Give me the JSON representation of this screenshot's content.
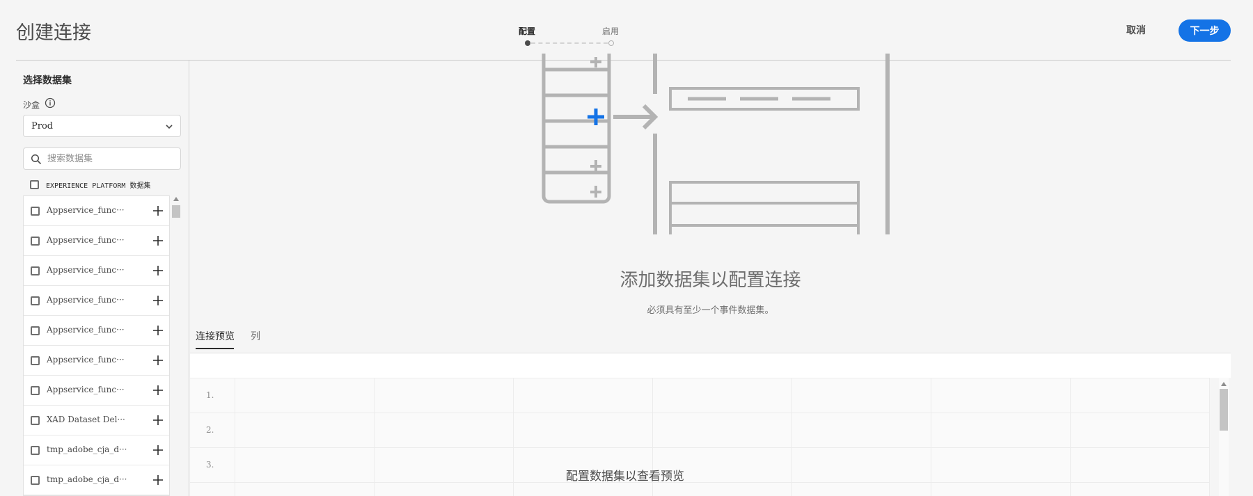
{
  "header": {
    "title": "创建连接",
    "steps": [
      "配置",
      "启用"
    ],
    "cancel_label": "取消",
    "next_label": "下一步"
  },
  "left_panel": {
    "title": "选择数据集",
    "sandbox_label": "沙盒",
    "sandbox_value": "Prod",
    "search_placeholder": "搜索数据集",
    "select_all_label": "EXPERIENCE PLATFORM 数据集",
    "datasets": [
      "Appservice_func···",
      "Appservice_func···",
      "Appservice_func···",
      "Appservice_func···",
      "Appservice_func···",
      "Appservice_func···",
      "Appservice_func···",
      "XAD Dataset Del···",
      "tmp_adobe_cja_d···",
      "tmp_adobe_cja_d···"
    ]
  },
  "main": {
    "empty_title": "添加数据集以配置连接",
    "empty_subtitle": "必须具有至少一个事件数据集。",
    "tabs": [
      "连接预览",
      "列"
    ],
    "grid_rows": [
      "1.",
      "2.",
      "3."
    ],
    "grid_message": "配置数据集以查看预览"
  },
  "colors": {
    "accent": "#1473e6",
    "illustration_gray": "#b3b3b3"
  }
}
